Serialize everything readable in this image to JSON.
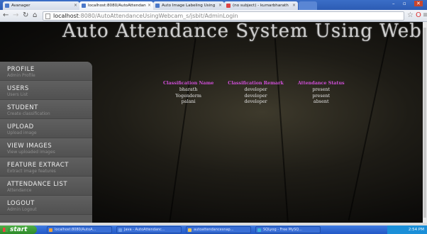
{
  "browser": {
    "tabs": [
      {
        "label": "Avanager"
      },
      {
        "label": "localhost:8080/AutoAttendan"
      },
      {
        "label": "Auto Image Labeling Using"
      },
      {
        "label": "(no subject) - kumarbharath"
      }
    ],
    "url_host": "localhost",
    "url_rest": ":8080/AutoAttendanceUsingWebcam_s/jsbit/AdminLogin"
  },
  "page": {
    "title": "Auto Attendance System Using Web Cam"
  },
  "sidebar": {
    "items": [
      {
        "label": "PROFILE",
        "sub": "Admin Profile"
      },
      {
        "label": "USERS",
        "sub": "Users List"
      },
      {
        "label": "STUDENT",
        "sub": "Create classification"
      },
      {
        "label": "UPLOAD",
        "sub": "Upload image"
      },
      {
        "label": "VIEW IMAGES",
        "sub": "View uploaded images"
      },
      {
        "label": "FEATURE EXTRACT",
        "sub": "Extract image features"
      },
      {
        "label": "ATTENDANCE LIST",
        "sub": "Attendance"
      },
      {
        "label": "LOGOUT",
        "sub": "Admin Logout"
      }
    ]
  },
  "table": {
    "headers": [
      "Classification Name",
      "Classification Remark",
      "Attendance Status"
    ],
    "rows": [
      [
        "bharath",
        "developer",
        "present"
      ],
      [
        "Yogenderm",
        "developer",
        "present"
      ],
      [
        "palani",
        "developer",
        "absent"
      ]
    ]
  },
  "taskbar": {
    "start": "start",
    "tasks": [
      {
        "label": "localhost:8080/AutoA..."
      },
      {
        "label": "Java - AutoAttendanc..."
      },
      {
        "label": "autoattendancesnap..."
      },
      {
        "label": "SQLyog - Free MySQ..."
      }
    ],
    "time": "2:54 PM"
  },
  "colors": {
    "header_accent": "#d04fd8",
    "sidebar_bg": "#5a5a5a",
    "taskbar": "#2258c7"
  }
}
